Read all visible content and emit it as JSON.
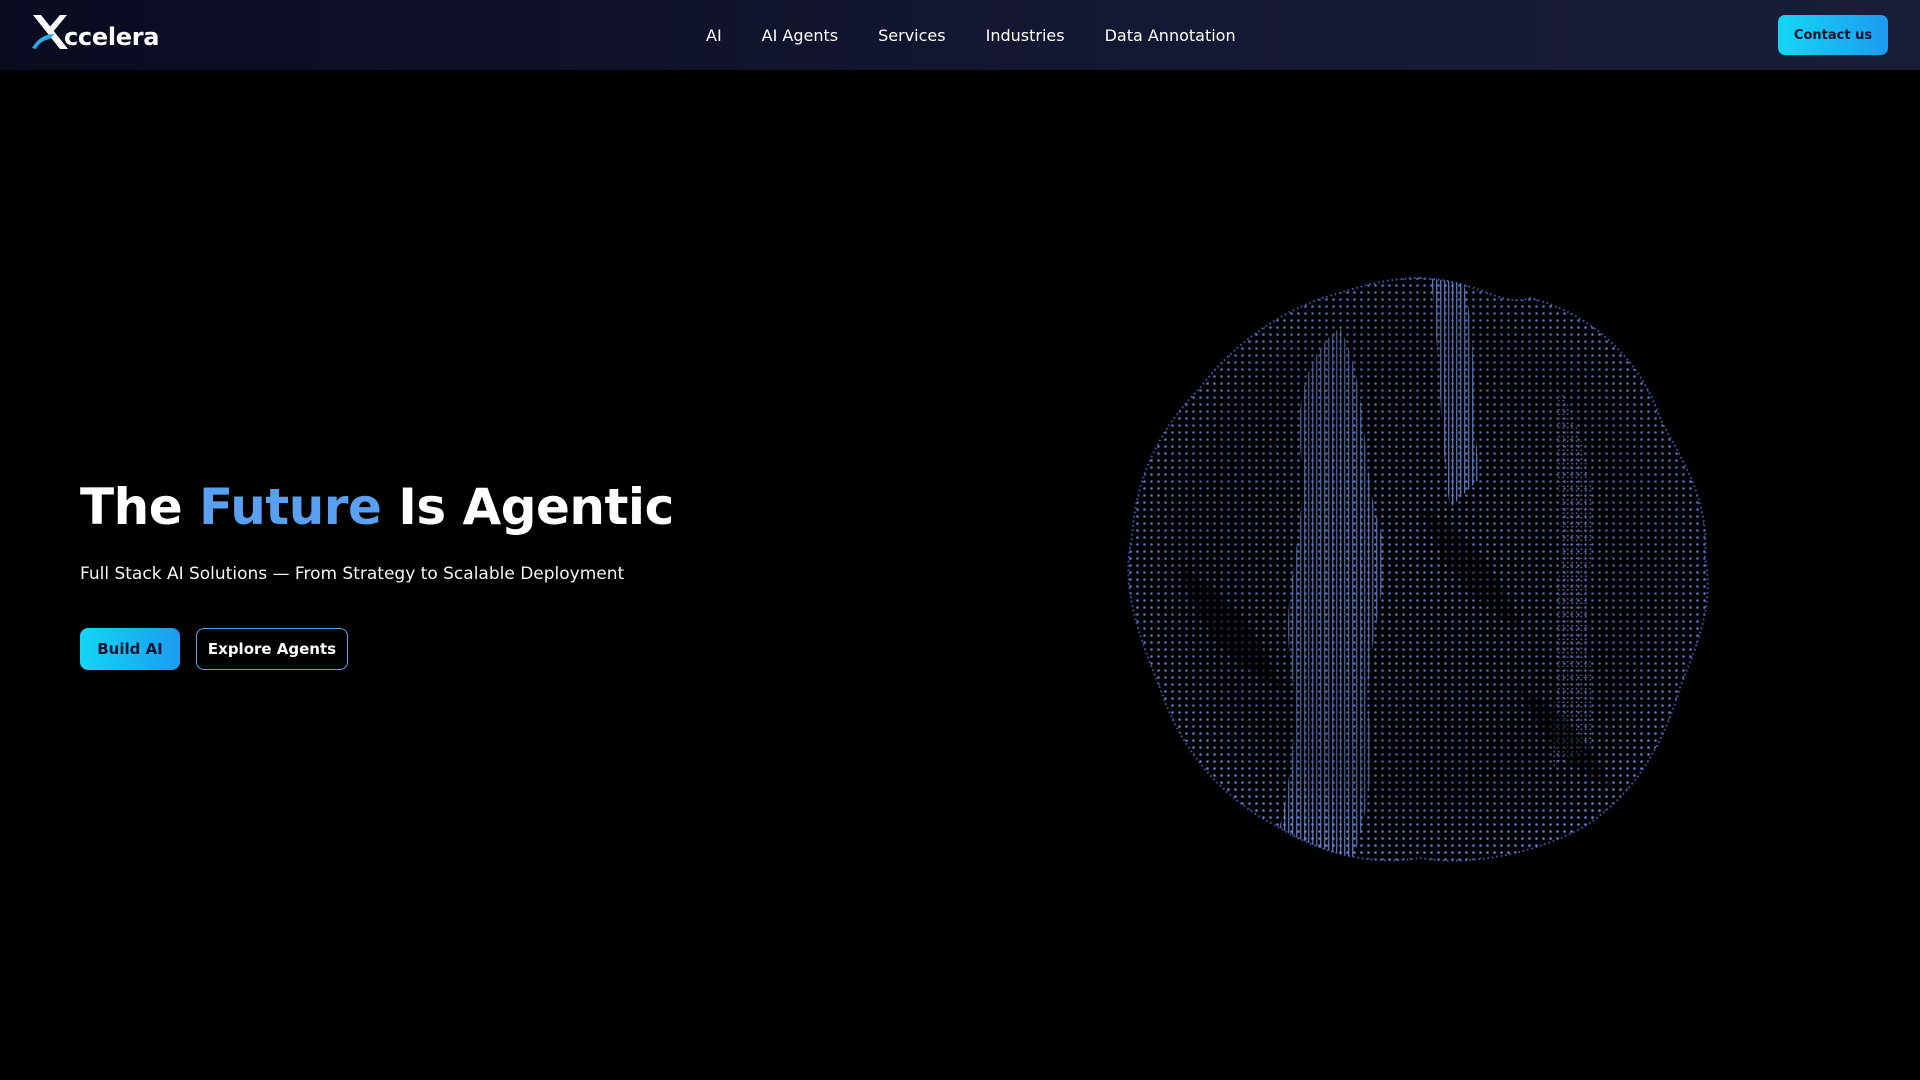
{
  "brand": {
    "logo_text": "ccelera",
    "colors": {
      "accent_blue": "#5aa0f2",
      "button_gradient_start": "#13d6f5",
      "button_gradient_end": "#1d9bf0",
      "background": "#000000",
      "nav_background": "#12142d",
      "orb_color": "#5b7fe0"
    }
  },
  "nav": {
    "links": [
      {
        "label": "AI"
      },
      {
        "label": "AI Agents"
      },
      {
        "label": "Services"
      },
      {
        "label": "Industries"
      },
      {
        "label": "Data Annotation"
      }
    ],
    "contact_label": "Contact us"
  },
  "hero": {
    "title_part1": "The ",
    "title_accent": "Future",
    "title_part2": " Is Agentic",
    "subtitle": "Full Stack AI Solutions — From Strategy to Scalable Deployment",
    "primary_cta": "Build AI",
    "secondary_cta": "Explore Agents"
  },
  "visual": {
    "icon": "particle-sphere-icon"
  }
}
